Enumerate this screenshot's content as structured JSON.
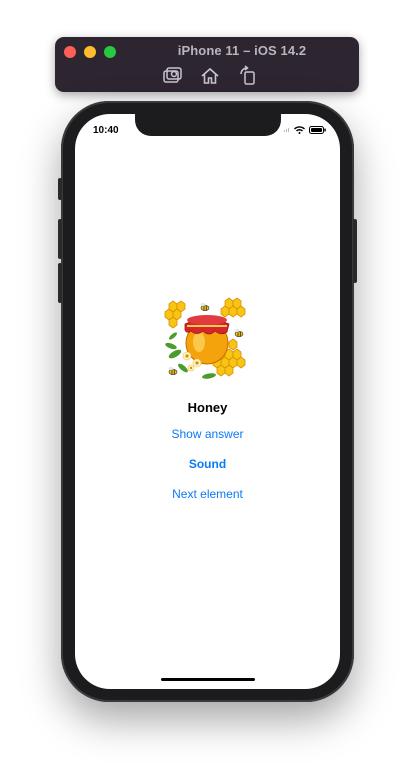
{
  "window": {
    "title": "iPhone 11 – iOS 14.2"
  },
  "toolbar": {
    "icons": [
      "screenshot-icon",
      "home-icon",
      "rotate-icon"
    ]
  },
  "status_bar": {
    "time": "10:40"
  },
  "card": {
    "image": "honey-jar-illustration",
    "word": "Honey",
    "show_answer_label": "Show answer",
    "sound_label": "Sound",
    "next_label": "Next element"
  },
  "colors": {
    "link": "#0a7af5",
    "title_bar": "#2d2630",
    "device": "#1c1c1e"
  }
}
